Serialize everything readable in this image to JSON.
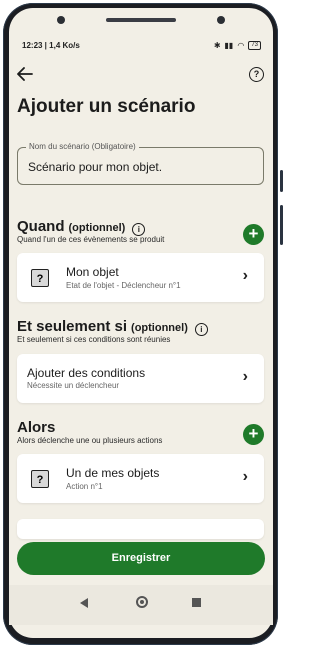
{
  "status_bar": {
    "time_speed": "12:23 | 1,4 Ko/s",
    "battery": "73"
  },
  "header": {
    "back_icon": "arrow-left-icon",
    "help_icon": "help-circle-icon",
    "title": "Ajouter un scénario"
  },
  "name_field": {
    "label": "Nom du scénario (Obligatoire)",
    "value": "Scénario pour mon objet."
  },
  "quand": {
    "title": "Quand",
    "optional": "(optionnel)",
    "subtitle": "Quand l'un de ces évènements se produit",
    "item": {
      "icon": "question-box-icon",
      "title": "Mon objet",
      "subtitle": "Etat de l'objet - Déclencheur n°1"
    }
  },
  "et_seulement": {
    "title": "Et seulement si",
    "optional": "(optionnel)",
    "subtitle": "Et seulement si ces conditions sont réunies",
    "item": {
      "title": "Ajouter des conditions",
      "subtitle": "Nécessite un déclencheur"
    }
  },
  "alors": {
    "title": "Alors",
    "subtitle": "Alors déclenche une ou plusieurs actions",
    "item": {
      "icon": "question-box-icon",
      "title": "Un de mes objets",
      "subtitle": "Action n°1"
    }
  },
  "save_button": "Enregistrer",
  "colors": {
    "accent": "#1f7a2a",
    "background": "#f2efe6",
    "card": "#ffffff"
  }
}
